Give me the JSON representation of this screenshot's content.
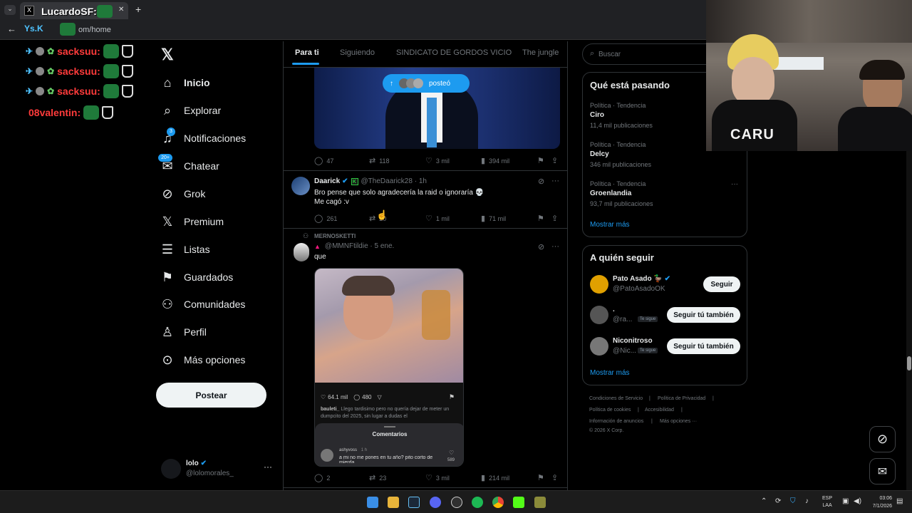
{
  "browser": {
    "tab_title": "LucardoSF:",
    "url": "om/home",
    "new_tab": "+",
    "close_tab": "✕"
  },
  "chat": {
    "lines": [
      {
        "user": "sacksuu:"
      },
      {
        "user": "sacksuu:"
      },
      {
        "user": "sacksuu:"
      },
      {
        "user": "08valentin:"
      }
    ],
    "overlay_tag": "Ys.K"
  },
  "nav": {
    "items": [
      {
        "label": "Inicio",
        "icon": "home-icon"
      },
      {
        "label": "Explorar",
        "icon": "search-icon"
      },
      {
        "label": "Notificaciones",
        "icon": "bell-icon",
        "badge": "3"
      },
      {
        "label": "Chatear",
        "icon": "mail-icon",
        "badge": "20+"
      },
      {
        "label": "Grok",
        "icon": "grok-icon"
      },
      {
        "label": "Premium",
        "icon": "x-icon"
      },
      {
        "label": "Listas",
        "icon": "list-icon"
      },
      {
        "label": "Guardados",
        "icon": "bookmark-icon"
      },
      {
        "label": "Comunidades",
        "icon": "people-icon"
      },
      {
        "label": "Perfil",
        "icon": "person-icon"
      },
      {
        "label": "Más opciones",
        "icon": "more-icon"
      }
    ],
    "post_button": "Postear",
    "account_name": "lolo",
    "account_handle": "@lolomorales_",
    "account_more": "···"
  },
  "feed": {
    "tabs": [
      "Para ti",
      "Siguiendo",
      "SINDICATO DE GORDOS VICIO",
      "The jungle"
    ],
    "new_posts_pill": "posteó",
    "post1": {
      "replies": "47",
      "reposts": "118",
      "likes": "3 mil",
      "views": "394 mil"
    },
    "post2": {
      "name": "Daarick",
      "handle": "@TheDaarick28 · 1h",
      "text1": "Bro pense que solo agradecería la raid o ignoraría 💀",
      "text2": "Me cagó :v",
      "replies": "261",
      "reposts": "20",
      "likes": "1 mil",
      "views": "71 mil"
    },
    "post3": {
      "context": "MERNOSKETTI",
      "handle": "@MMNFtildie · 5 ene.",
      "text": "que",
      "video_likes": "64.1 mil",
      "video_comments": "480",
      "video_caption_user": "bauleti_",
      "video_caption": "Llego tardisimo pero no quería dejar de meter un dumpcito del 2025, sin lugar a dudas el",
      "comments_title": "Comentarios",
      "comment_user": "ashyvoss",
      "comment_time": "1 h",
      "comment_text": "a mi no me pones en tu año? pito corto de mierda",
      "comment_likes": "589",
      "replies": "2",
      "reposts": "23",
      "likes": "3 mil",
      "views": "214 mil"
    }
  },
  "right": {
    "search_placeholder": "Buscar",
    "trends_title": "Qué está pasando",
    "trends": [
      {
        "meta": "Política · Tendencia",
        "name": "Ciro",
        "count": "11,4 mil publicaciones"
      },
      {
        "meta": "Política · Tendencia",
        "name": "Delcy",
        "count": "346 mil publicaciones"
      },
      {
        "meta": "Política · Tendencia",
        "name": "Groenlandia",
        "count": "93,7 mil publicaciones"
      }
    ],
    "show_more": "Mostrar más",
    "follow_title": "A quién seguir",
    "follow": [
      {
        "name": "Pato Asado 🦆",
        "handle": "@PatoAsadoOK",
        "button": "Seguir",
        "tag": ""
      },
      {
        "name": ".",
        "handle": "@ra...",
        "button": "Seguir tú también",
        "tag": "Te sigue"
      },
      {
        "name": "Niconitroso",
        "handle": "@Nic...",
        "button": "Seguir tú también",
        "tag": "Te sigue"
      }
    ],
    "footer": [
      "Condiciones de Servicio",
      "Política de Privacidad",
      "Política de cookies",
      "Accesibilidad",
      "Información de anuncios",
      "Más opciones ···",
      "© 2026 X Corp."
    ]
  },
  "taskbar": {
    "lang": "ESP",
    "lang2": "LAA",
    "time": "03:06",
    "date": "7/1/2026"
  },
  "webcam": {
    "cap_text": "CARU"
  }
}
